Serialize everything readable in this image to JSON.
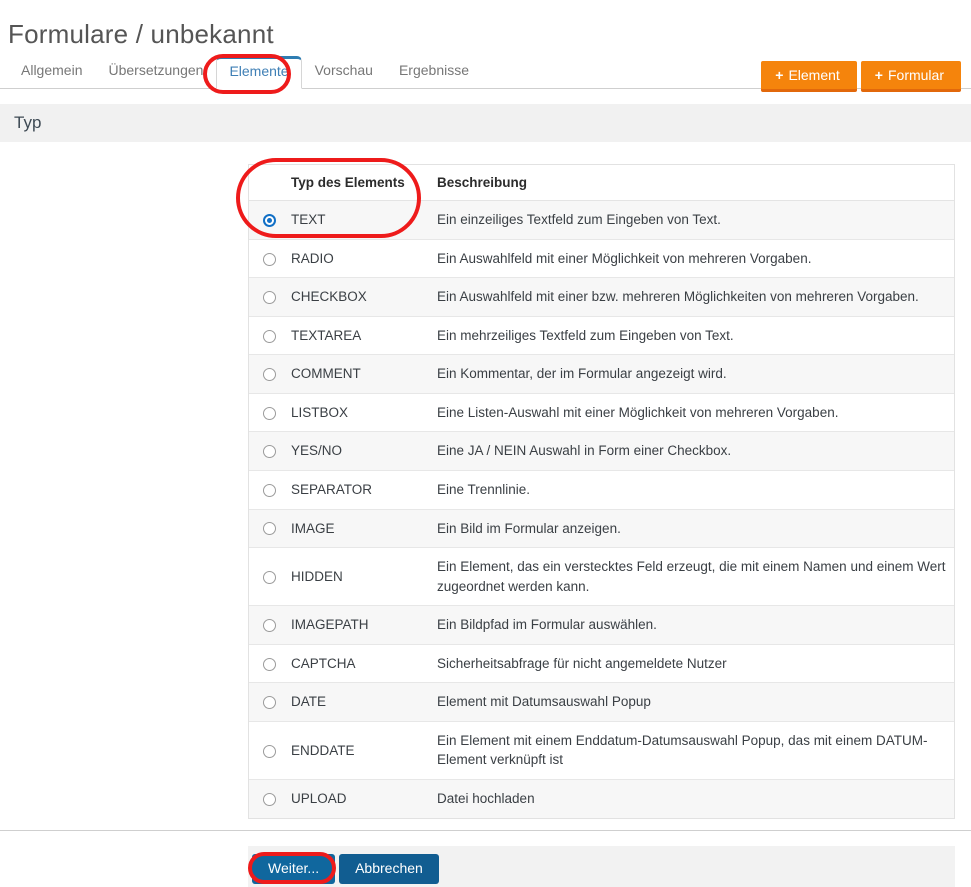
{
  "page": {
    "title": "Formulare / unbekannt"
  },
  "tabs": [
    {
      "label": "Allgemein",
      "active": false
    },
    {
      "label": "Übersetzungen",
      "active": false
    },
    {
      "label": "Elemente",
      "active": true
    },
    {
      "label": "Vorschau",
      "active": false
    },
    {
      "label": "Ergebnisse",
      "active": false
    }
  ],
  "top_actions": [
    {
      "label": "Element",
      "icon": "plus-icon",
      "plus": "+"
    },
    {
      "label": "Formular",
      "icon": "plus-icon",
      "plus": "+"
    }
  ],
  "section": {
    "label": "Typ"
  },
  "table": {
    "columns": {
      "radio": "",
      "type": "Typ des Elements",
      "description": "Beschreibung"
    },
    "rows": [
      {
        "selected": true,
        "type": "TEXT",
        "description": "Ein einzeiliges Textfeld zum Eingeben von Text."
      },
      {
        "selected": false,
        "type": "RADIO",
        "description": "Ein Auswahlfeld mit einer Möglichkeit von mehreren Vorgaben."
      },
      {
        "selected": false,
        "type": "CHECKBOX",
        "description": "Ein Auswahlfeld mit einer bzw. mehreren Möglichkeiten von mehreren Vorgaben."
      },
      {
        "selected": false,
        "type": "TEXTAREA",
        "description": "Ein mehrzeiliges Textfeld zum Eingeben von Text."
      },
      {
        "selected": false,
        "type": "COMMENT",
        "description": "Ein Kommentar, der im Formular angezeigt wird."
      },
      {
        "selected": false,
        "type": "LISTBOX",
        "description": "Eine Listen-Auswahl mit einer Möglichkeit von mehreren Vorgaben."
      },
      {
        "selected": false,
        "type": "YES/NO",
        "description": "Eine JA / NEIN Auswahl in Form einer Checkbox."
      },
      {
        "selected": false,
        "type": "SEPARATOR",
        "description": "Eine Trennlinie."
      },
      {
        "selected": false,
        "type": "IMAGE",
        "description": "Ein Bild im Formular anzeigen."
      },
      {
        "selected": false,
        "type": "HIDDEN",
        "description": "Ein Element, das ein verstecktes Feld erzeugt, die mit einem Namen und einem Wert zugeordnet werden kann."
      },
      {
        "selected": false,
        "type": "IMAGEPATH",
        "description": "Ein Bildpfad im Formular auswählen."
      },
      {
        "selected": false,
        "type": "CAPTCHA",
        "description": "Sicherheitsabfrage für nicht angemeldete Nutzer"
      },
      {
        "selected": false,
        "type": "DATE",
        "description": "Element mit Datumsauswahl Popup"
      },
      {
        "selected": false,
        "type": "ENDDATE",
        "description": "Ein Element mit einem Enddatum-Datumsauswahl Popup, das mit einem DATUM-Element verknüpft ist"
      },
      {
        "selected": false,
        "type": "UPLOAD",
        "description": "Datei hochladen"
      }
    ]
  },
  "footer": {
    "next_label": "Weiter...",
    "cancel_label": "Abbrechen"
  },
  "colors": {
    "accent_orange": "#f5840c",
    "accent_orange_dark": "#e2680b",
    "accent_blue": "#10679e",
    "tab_active": "#2e7db2",
    "radio_selected": "#1270c6",
    "annotation_red": "#ee1b1b",
    "section_bar": "#f1f1f1",
    "row_alt": "#f7f7f7"
  }
}
